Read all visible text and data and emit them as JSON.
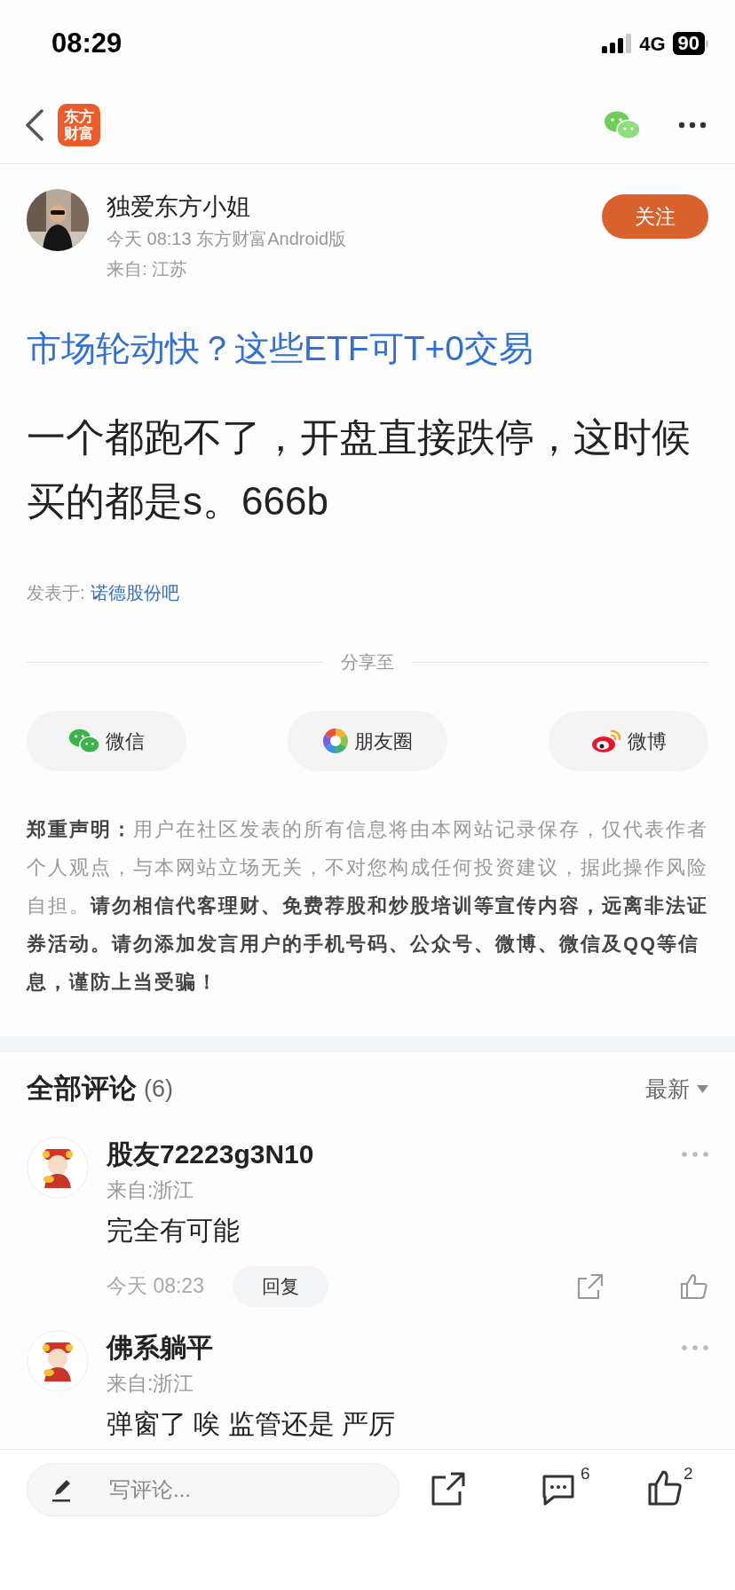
{
  "status_bar": {
    "time": "08:29",
    "network": "4G",
    "battery": "90"
  },
  "nav": {
    "logo": "东方财富"
  },
  "post": {
    "author": "独爱东方小姐",
    "meta": "今天 08:13 东方财富Android版",
    "location": "来自: 江苏",
    "follow_label": "关注",
    "title": "市场轮动快？这些ETF可T+0交易",
    "body": "一个都跑不了，开盘直接跌停，这时候买的都是s。666b",
    "posted_in_label": "发表于:",
    "posted_in": "诺德股份吧"
  },
  "share": {
    "label": "分享至",
    "targets": [
      {
        "kind": "wechat",
        "label": "微信"
      },
      {
        "kind": "moments",
        "label": "朋友圈"
      },
      {
        "kind": "weibo",
        "label": "微博"
      }
    ]
  },
  "disclaimer": "**郑重声明：**用户在社区发表的所有信息将由本网站记录保存，仅代表作者个人观点，与本网站立场无关，不对您构成任何投资建议，据此操作风险自担。**请勿相信代客理财、免费荐股和炒股培训等宣传内容，远离非法证券活动。请勿添加发言用户的手机号码、公众号、微博、微信及QQ等信息，谨防上当受骗！**",
  "comments_header": {
    "title": "全部评论",
    "count": "(6)",
    "sort": "最新"
  },
  "comments": [
    {
      "user": "股友72223g3N10",
      "location": "来自:浙江",
      "text": "完全有可能",
      "time": "今天 08:23",
      "reply_label": "回复"
    },
    {
      "user": "佛系躺平",
      "location": "来自:浙江",
      "text": "弹窗了 唉 监管还是 严厉"
    }
  ],
  "bottom_bar": {
    "placeholder": "写评论...",
    "comment_count": "6",
    "like_count": "2"
  }
}
